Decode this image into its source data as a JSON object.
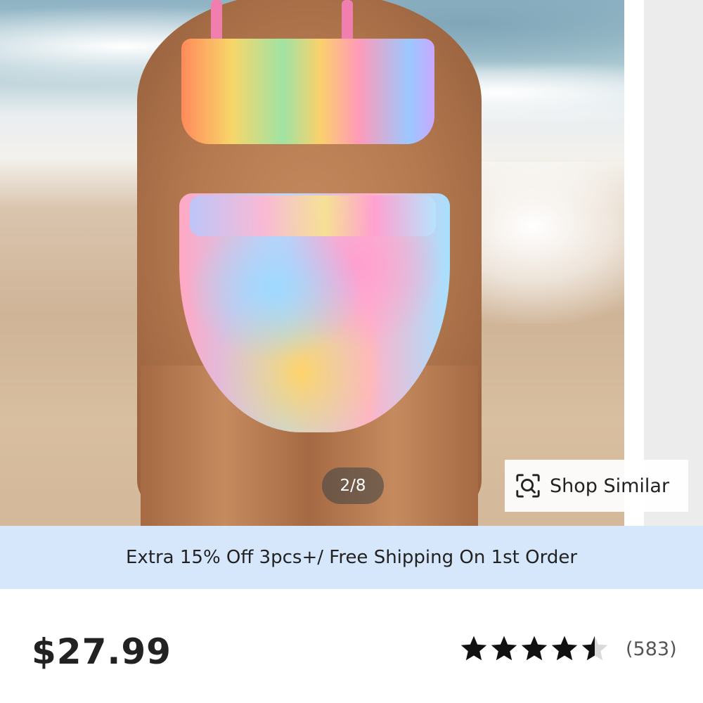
{
  "gallery": {
    "counter": "2/8",
    "shop_similar_label": "Shop Similar"
  },
  "promo": {
    "text": "Extra 15% Off 3pcs+/ Free Shipping On 1st Order"
  },
  "product": {
    "price": "$27.99",
    "rating": 4.5,
    "review_count": "(583)"
  },
  "icons": {
    "shop_similar": "image-search-icon",
    "rating": "star-icon"
  },
  "colors": {
    "promo_bg": "#d6e7fb",
    "text": "#222222",
    "star": "#111111",
    "star_empty": "#d9d9d9"
  }
}
